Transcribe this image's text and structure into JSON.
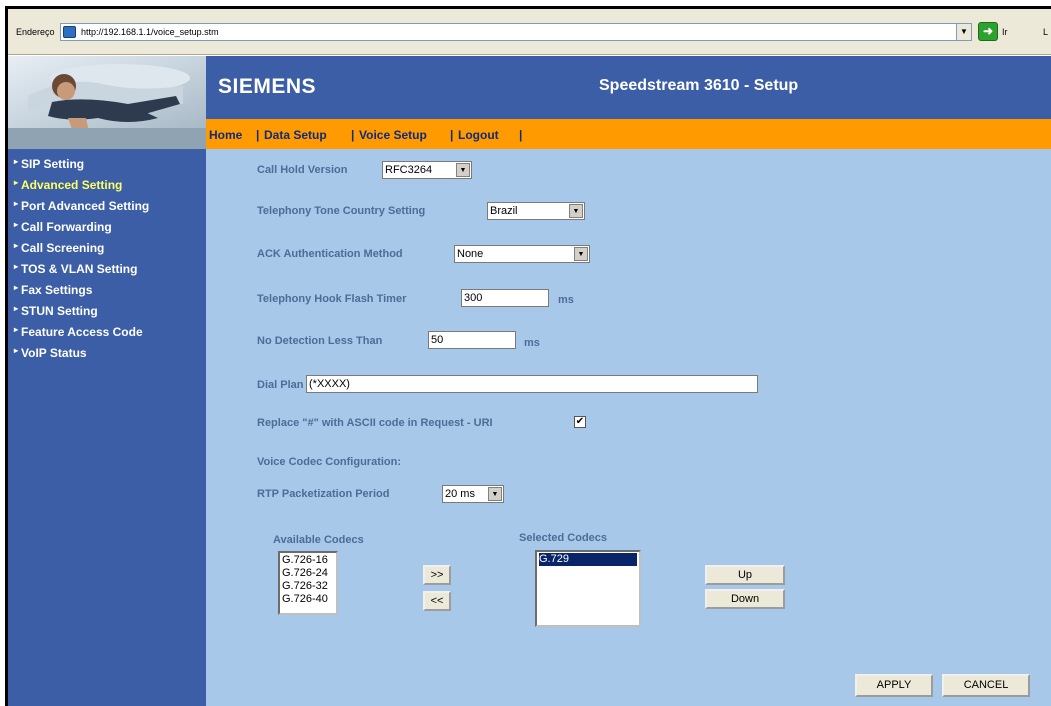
{
  "address_bar": {
    "label": "Endereço",
    "url": "http://192.168.1.1/voice_setup.stm",
    "go_label": "Ir",
    "links_label": "L"
  },
  "header": {
    "brand": "SIEMENS",
    "product": "Speedstream 3610  -  Setup"
  },
  "nav": {
    "items": [
      "Home",
      "Data Setup",
      "Voice Setup",
      "Logout"
    ],
    "separator": "|"
  },
  "sidebar": {
    "items": [
      {
        "label": "SIP Setting",
        "active": false
      },
      {
        "label": "Advanced Setting",
        "active": true
      },
      {
        "label": "Port Advanced Setting",
        "active": false
      },
      {
        "label": "Call Forwarding",
        "active": false
      },
      {
        "label": "Call Screening",
        "active": false
      },
      {
        "label": "TOS & VLAN Setting",
        "active": false
      },
      {
        "label": "Fax Settings",
        "active": false
      },
      {
        "label": "STUN Setting",
        "active": false
      },
      {
        "label": "Feature Access Code",
        "active": false
      },
      {
        "label": "VoIP Status",
        "active": false
      }
    ]
  },
  "form": {
    "call_hold": {
      "label": "Call Hold Version",
      "value": "RFC3264"
    },
    "tone_country": {
      "label": "Telephony Tone Country Setting",
      "value": "Brazil"
    },
    "ack_auth": {
      "label": "ACK Authentication Method",
      "value": "None"
    },
    "hook_flash": {
      "label": "Telephony Hook Flash Timer",
      "value": "300",
      "unit": "ms"
    },
    "no_detection": {
      "label": "No Detection Less Than",
      "value": "50",
      "unit": "ms"
    },
    "dial_plan": {
      "label": "Dial Plan",
      "value": "(*XXXX)"
    },
    "replace_hash": {
      "label": "Replace \"#\" with ASCII code in Request - URI",
      "checked": true,
      "mark": "✔"
    },
    "codec_config_label": "Voice Codec Configuration:",
    "rtp_period": {
      "label": "RTP Packetization Period",
      "value": "20 ms"
    }
  },
  "codecs": {
    "available_label": "Available Codecs",
    "selected_label": "Selected Codecs",
    "available": [
      "G.726-16",
      "G.726-24",
      "G.726-32",
      "G.726-40"
    ],
    "selected": [
      "G.729"
    ],
    "add_label": ">>",
    "remove_label": "<<",
    "up_label": "Up",
    "down_label": "Down"
  },
  "actions": {
    "apply_label": "APPLY",
    "cancel_label": "CANCEL"
  }
}
